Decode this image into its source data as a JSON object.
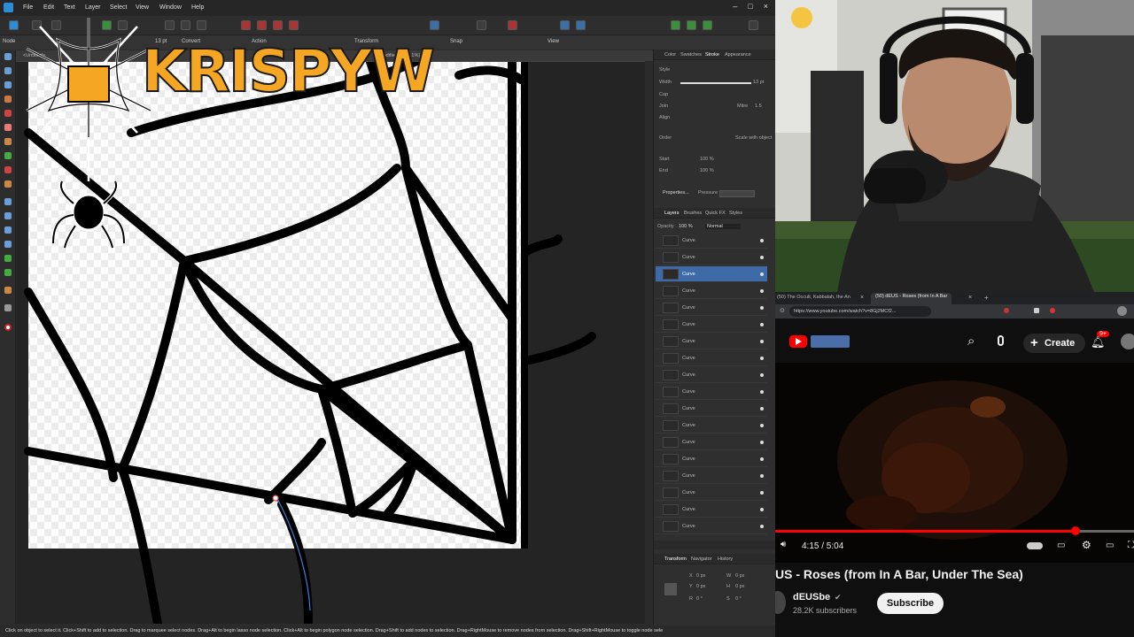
{
  "affinity": {
    "menu": [
      "File",
      "Edit",
      "Text",
      "Layer",
      "Select",
      "View",
      "Window",
      "Help"
    ],
    "context": {
      "node_label": "Node",
      "convert_label": "Convert",
      "action_label": "Action",
      "transform_label": "Transform",
      "snap_label": "Snap",
      "view_label": "View",
      "stroke_size": "13 pt"
    },
    "doc_tab": "<Untitled>",
    "doc_tab_suffix": "Modified) [244.1%]",
    "status": "Click on object to select it. Click+Shift to add to selection. Drag to marquee select nodes. Drag+Alt to begin lasso node selection. Click+Alt to begin polygon node selection. Drag+Shift to add nodes to selection. Drag+RightMouse to remove nodes from selection. Drag+Shift+RightMouse to toggle node sele",
    "overlay_logo_text": "KRISPYW",
    "panels": {
      "top_tabs": [
        "Color",
        "Swatches",
        "Stroke",
        "Appearance"
      ],
      "style_label": "Style",
      "width_label": "Width",
      "width_value": "13 pt",
      "cap_label": "Cap",
      "join_label": "Join",
      "align_label": "Align",
      "mitre_label": "Mitre",
      "mitre_value": "1.5",
      "order_label": "Order",
      "scale_label": "Scale with object",
      "start_label": "Start",
      "end_label": "End",
      "start_pct": "100 %",
      "end_pct": "100 %",
      "properties_label": "Properties...",
      "pressure_label": "Pressure",
      "layer_tabs": [
        "Layers",
        "Brushes",
        "Quick FX",
        "Styles"
      ],
      "opacity_label": "Opacity",
      "opacity_value": "100 %",
      "blend_mode": "Normal",
      "layers": [
        "Curve",
        "Curve",
        "Curve",
        "Curve",
        "Curve",
        "Curve",
        "Curve",
        "Curve",
        "Curve",
        "Curve",
        "Curve",
        "Curve",
        "Curve",
        "Curve",
        "Curve",
        "Curve",
        "Curve",
        "Curve"
      ],
      "bottom_tabs": [
        "Transform",
        "Navigator",
        "History"
      ],
      "transform_fields": [
        "X",
        "Y",
        "W",
        "H",
        "R",
        "S"
      ],
      "transform_values": [
        "0 px",
        "0 px",
        "0 px",
        "0 px",
        "0 °",
        "0 °"
      ]
    }
  },
  "browser": {
    "tabs": [
      "(50) The Occult, Kabbalah, the An",
      "(50) dEUS - Roses (from In A Bar"
    ],
    "url": "https://www.youtube.com/watch?v=8Gj2MCf2...",
    "create_label": "Create",
    "notif_count": "9+",
    "time": "4:15 / 5:04",
    "progress": 0.8375,
    "video_title": "US - Roses (from In A Bar, Under The Sea)",
    "channel": "dEUSbe",
    "subscribers": "28.2K subscribers",
    "subscribe_label": "Subscribe"
  },
  "colors": {
    "accent_blue": "#3e6aa8",
    "logo_orange": "#f5a623",
    "yt_red": "#ff0000"
  }
}
